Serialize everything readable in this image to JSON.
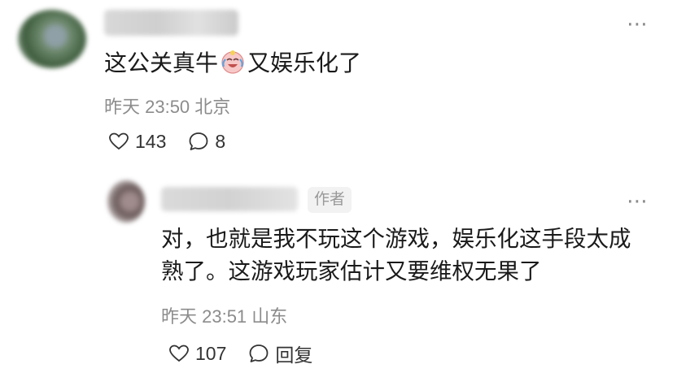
{
  "comment": {
    "text_before_emoji": "这公关真牛",
    "emoji_name": "crying-laughing-face-emoji",
    "text_after_emoji": "又娱乐化了",
    "time": "昨天 23:50",
    "location": "北京",
    "likes": "143",
    "replies": "8",
    "more_icon": "more-dots-icon"
  },
  "reply": {
    "author_badge": "作者",
    "text": "对，也就是我不玩这个游戏，娱乐化这手段太成熟了。这游戏玩家估计又要维权无果了",
    "time": "昨天 23:51",
    "location": "山东",
    "likes": "107",
    "reply_label": "回复",
    "more_icon": "more-dots-icon"
  },
  "colors": {
    "secondary_text": "#8c8c8c",
    "badge_bg": "#f2f2f2",
    "main_text": "#1a1a1a"
  }
}
